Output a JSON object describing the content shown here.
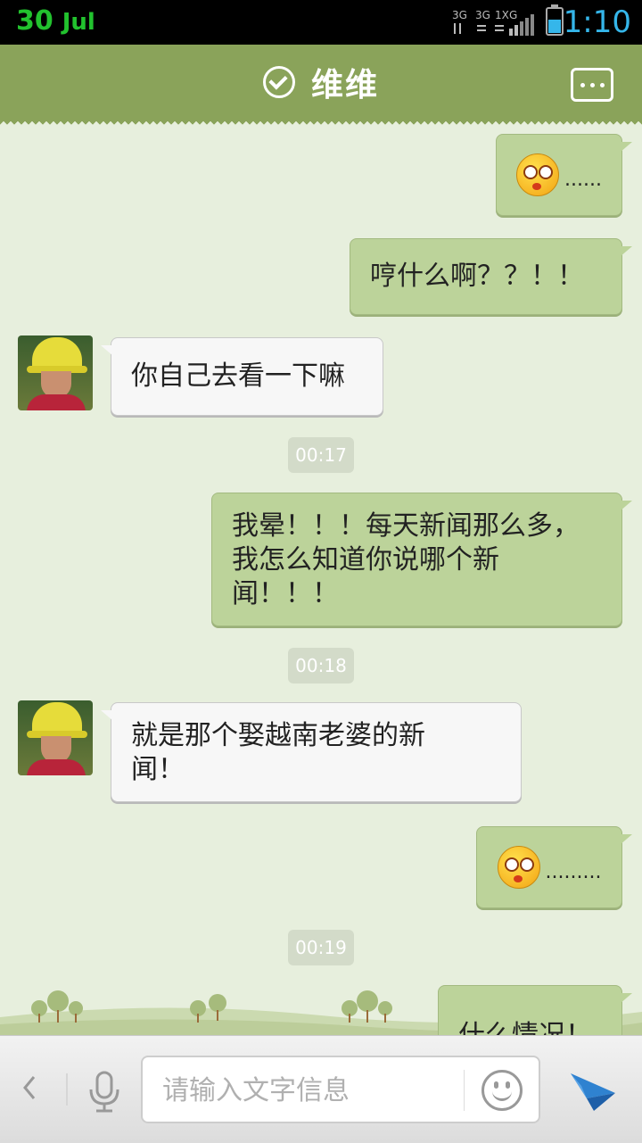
{
  "status_bar": {
    "date_day": "30",
    "date_month": "Jul",
    "network": "3G 3G 1X G",
    "time": "1:10",
    "battery_icon": "battery-icon"
  },
  "header": {
    "title": "维维",
    "verified_icon": "check-circle-icon",
    "menu_icon": "more-icon"
  },
  "messages": [
    {
      "side": "me",
      "type": "emoji",
      "text": "......"
    },
    {
      "side": "me",
      "type": "text",
      "text": "哼什么啊？？！！"
    },
    {
      "side": "them",
      "type": "text",
      "text": "你自己去看一下嘛"
    },
    {
      "type": "timestamp",
      "text": "00:17"
    },
    {
      "side": "me",
      "type": "text",
      "text": "我晕！！！每天新闻那么多，我怎么知道你说哪个新闻！！！"
    },
    {
      "type": "timestamp",
      "text": "00:18"
    },
    {
      "side": "them",
      "type": "text",
      "text": "就是那个娶越南老婆的新闻！"
    },
    {
      "side": "me",
      "type": "emoji",
      "text": "........."
    },
    {
      "type": "timestamp",
      "text": "00:19"
    },
    {
      "side": "me",
      "type": "text",
      "text": "什么情况！"
    }
  ],
  "input_bar": {
    "placeholder": "请输入文字信息",
    "back_icon": "chevron-left-icon",
    "mic_icon": "microphone-icon",
    "emoji_icon": "smiley-icon",
    "send_icon": "send-icon"
  },
  "colors": {
    "header_bg": "#8aa35a",
    "chat_bg": "#e7efdd",
    "my_bubble": "#bcd39a",
    "their_bubble": "#f7f7f7",
    "time_color": "#35b6ea",
    "date_color": "#22c22e"
  }
}
